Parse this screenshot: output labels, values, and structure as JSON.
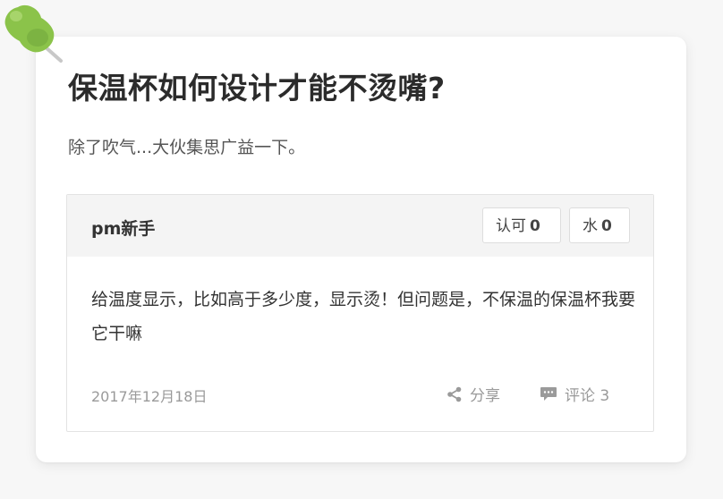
{
  "question": {
    "title": "保温杯如何设计才能不烫嘴?",
    "description": "除了吹气...大伙集思广益一下。"
  },
  "answer": {
    "author": "pm新手",
    "approve_label": "认可",
    "approve_count": "0",
    "water_label": "水",
    "water_count": "0",
    "body": "给温度显示，比如高于多少度，显示烫！但问题是，不保温的保温杯我要它干嘛",
    "date": "2017年12月18日",
    "share_label": "分享",
    "comment_label": "评论 3"
  },
  "icons": {
    "pin": "pushpin-icon",
    "share": "share-icon",
    "comment": "comment-icon"
  },
  "colors": {
    "pin_green": "#8bc34a",
    "text_dark": "#2b2b2b",
    "muted": "#9a9a9a"
  }
}
